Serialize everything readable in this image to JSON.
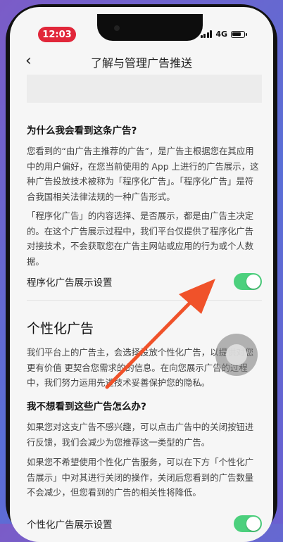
{
  "status_bar": {
    "time": "12:03",
    "network": "4G"
  },
  "nav": {
    "back_glyph": "‹",
    "title": "了解与管理广告推送"
  },
  "sections": {
    "why_title": "为什么我会看到这条广告?",
    "why_p1": "您看到的“由广告主推荐的广告”，是广告主根据您在其应用中的用户偏好，在您当前使用的 App 上进行的广告展示，这种广告投放技术被称为「程序化广告」。「程序化广告」是符合我国相关法律法规的一种广告形式。",
    "why_p2": "「程序化广告」的内容选择、是否展示，都是由广告主决定的。在这个广告展示过程中，我们平台仅提供了程序化广告对接技术，不会获取您在广告主网站或应用的行为或个人数据。",
    "programmatic_setting_label": "程序化广告展示设置",
    "personalized_title": "个性化广告",
    "personalized_p1": "我们平台上的广告主，会选择投放个性化广告，以提供对您更有价值 更契合您需求的的信息。在向您展示广告的过程中，我们努力运用先进技术妥善保护您的隐私。",
    "dont_want_title": "我不想看到这些广告怎么办?",
    "dont_want_p1": "如果您对这支广告不感兴趣，可以点击广告中的关闭按钮进行反馈，我们会减少为您推荐这一类型的广告。",
    "dont_want_p2": "如果您不希望使用个性化广告服务，可以在下方「个性化广告展示」中对其进行关闭的操作，关闭后您看到的广告数量不会减少，但您看到的广告的相关性将降低。",
    "personalized_setting_label": "个性化广告展示设置"
  },
  "toggles": {
    "programmatic_on": true,
    "personalized_on": true
  },
  "colors": {
    "toggle_on": "#4cd07d",
    "time_pill": "#e1273a",
    "arrow": "#f0522a"
  }
}
